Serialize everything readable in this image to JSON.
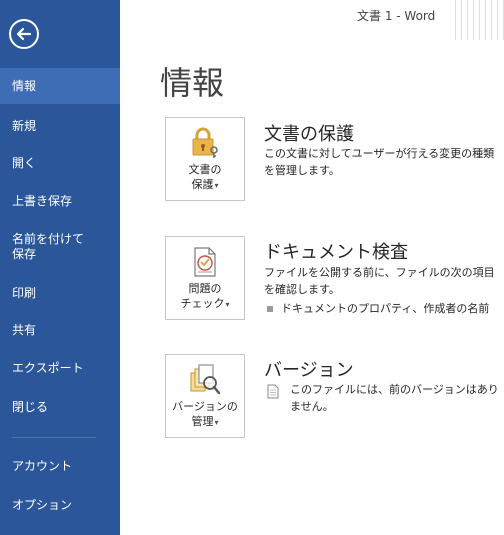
{
  "window": {
    "title": "文書 1 - Word"
  },
  "sidebar": {
    "back_icon": "back-arrow-icon",
    "colors": {
      "background": "#2b579a",
      "selected": "#3e6db5"
    },
    "items": [
      {
        "label": "情報"
      },
      {
        "label": "新規"
      },
      {
        "label": "開く"
      },
      {
        "label": "上書き保存"
      },
      {
        "label": "名前を付けて\n保存"
      },
      {
        "label": "印刷"
      },
      {
        "label": "共有"
      },
      {
        "label": "エクスポート"
      },
      {
        "label": "閉じる"
      },
      {
        "label": "アカウント"
      },
      {
        "label": "オプション"
      }
    ],
    "selected": "情報"
  },
  "main": {
    "page_title": "情報",
    "sections": [
      {
        "tile_line1": "文書の",
        "tile_line2": "保護",
        "tile_icon": "lock-key-icon",
        "title": "文書の保護",
        "description": "この文書に対してユーザーが行える変更の種類を管理します。"
      },
      {
        "tile_line1": "問題の",
        "tile_line2": "チェック",
        "tile_icon": "document-check-icon",
        "title": "ドキュメント検査",
        "description": "ファイルを公開する前に、ファイルの次の項目を確認します。",
        "bullets": [
          "ドキュメントのプロパティ、作成者の名前"
        ]
      },
      {
        "tile_line1": "バージョンの",
        "tile_line2": "管理",
        "tile_icon": "versions-magnifier-icon",
        "title": "バージョン",
        "description": "このファイルには、前のバージョンはありません。",
        "description_icon": "document-icon"
      }
    ]
  }
}
